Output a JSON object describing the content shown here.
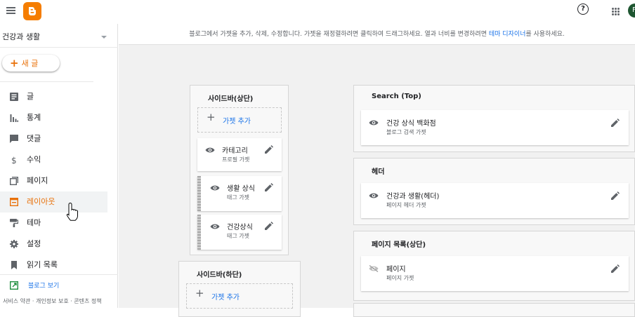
{
  "topbar": {
    "menu_icon": "hamburger-menu-icon",
    "logo_icon": "blogger-logo-icon",
    "help_icon": "help-icon",
    "help_glyph": "?",
    "apps_icon": "apps-grid-icon",
    "avatar_letter": "F"
  },
  "sidebar": {
    "blog_name": "건강과 생활",
    "new_post_label": "새 글",
    "nav": [
      {
        "label": "글",
        "icon": "posts-icon"
      },
      {
        "label": "통계",
        "icon": "stats-icon"
      },
      {
        "label": "댓글",
        "icon": "comments-icon"
      },
      {
        "label": "수익",
        "icon": "earnings-icon"
      },
      {
        "label": "페이지",
        "icon": "pages-icon"
      },
      {
        "label": "레이아웃",
        "icon": "layout-icon",
        "active": true
      },
      {
        "label": "테마",
        "icon": "theme-icon"
      },
      {
        "label": "설정",
        "icon": "settings-icon"
      },
      {
        "label": "읽기 목록",
        "icon": "reading-list-icon"
      }
    ],
    "view_blog_label": "블로그 보기",
    "footer_links": "서비스 약관 · 개인정보 보호 · 콘텐츠 정책"
  },
  "main": {
    "info_prefix": "블로그에서 가젯을 추가, 삭제, 수정합니다. 가젯을 재정렬하려면 클릭하여 드래그하세요. 열과 너비를 변경하려면 ",
    "info_link": "테마 디자이너",
    "info_suffix": "를 사용하세요.",
    "sidebar_top": {
      "title": "사이드바(상단)",
      "add_gadget": "가젯 추가",
      "gadgets": [
        {
          "title": "카테고리",
          "sub": "프로필 가젯"
        },
        {
          "title": "생활 상식",
          "sub": "태그 가젯"
        },
        {
          "title": "건강상식",
          "sub": "태그 가젯"
        }
      ]
    },
    "sidebar_bottom": {
      "title": "사이드바(하단)",
      "add_gadget": "가젯 추가"
    },
    "search_top": {
      "title": "Search (Top)",
      "gadget": {
        "title": "건강 상식 백화점",
        "sub": "블로그 검색 가젯"
      }
    },
    "header": {
      "title": "헤더",
      "gadget": {
        "title": "건강과 생활(헤더)",
        "sub": "페이지 헤더 가젯"
      }
    },
    "page_list": {
      "title": "페이지 목록(상단)",
      "gadget": {
        "title": "페이지",
        "sub": "페이지 가젯"
      }
    }
  },
  "colors": {
    "accent": "#e8710a",
    "link": "#1a73e8",
    "logo": "#f57d00"
  }
}
